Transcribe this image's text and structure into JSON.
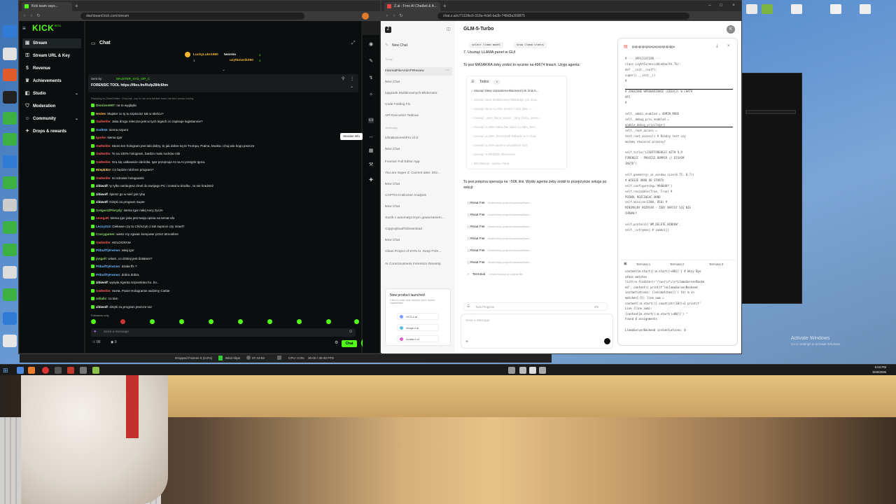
{
  "kick_browser": {
    "tab_title": "Kick team says...",
    "url": "dashboard.kick.com/stream",
    "logo": "KICK",
    "logo_badge": "BETA",
    "nav": [
      {
        "label": "Stream",
        "icon": "stream-icon"
      },
      {
        "label": "Stream URL & Key",
        "icon": "key-icon"
      },
      {
        "label": "Revenue",
        "icon": "dollar-icon"
      },
      {
        "label": "Achievements",
        "icon": "trophy-icon"
      },
      {
        "label": "Studio",
        "icon": "studio-icon"
      },
      {
        "label": "Moderation",
        "icon": "shield-icon"
      },
      {
        "label": "Community",
        "icon": "users-icon"
      },
      {
        "label": "Drops & rewards",
        "icon": "gift-icon"
      }
    ],
    "chat": {
      "title": "Chat",
      "leaderboard": [
        {
          "name": "LuckyLuke1980",
          "count": "1"
        },
        {
          "name": "tworms",
          "count": "1"
        },
        {
          "name": "uzytkownik090",
          "count": "1"
        }
      ],
      "pinned_sender": "Sent by",
      "pinned_user": "MAJSTER_SYS_VIP_C",
      "pinned_text": "FORENSIC TOOL https://files.fm/f/ufp284c6hm",
      "replying": "Replying to ZbmOrbiter: Chuj wie, czy to nie ona bedzie konu nie bez sensu trochę",
      "messages": [
        {
          "user": "Dionizos997",
          "text": "na to wygląda",
          "color": "#8fd36f"
        },
        {
          "user": "Hede6",
          "text": "Majster co ty tu szpiocisz tak w słońcu?",
          "color": "#ffb347"
        },
        {
          "user": "Owl5elite",
          "text": "Jaka droga mleczna jest w tych legach co zapisuje logistiannie?",
          "color": "#ff5c5c"
        },
        {
          "user": "SodKW",
          "text": "siema szpont",
          "color": "#6fb7ff"
        },
        {
          "user": "Igorke",
          "text": "siema Igor",
          "color": "#ff5c5c"
        },
        {
          "user": "Owl5elite",
          "text": "Skoro ten hologram jest taki dobry, to jak dobre są te Trumpa, Putina, Muska i chuj wie kogo jeszcze",
          "color": "#ff5c5c"
        },
        {
          "user": "Owl5elite",
          "text": "To na 100% hologram, bardzo mało ruchów robi",
          "color": "#ff5c5c"
        },
        {
          "user": "Owl5elite",
          "text": "Gra się całkowicie obróciła. Igor przejmuje AI na AI przejęło Igora.",
          "color": "#ff5c5c"
        },
        {
          "user": "WiepkiDJ",
          "text": "Co będzie robił ten program?",
          "color": "#ffd56f"
        },
        {
          "user": "Owl5elite",
          "text": "no zdrowie hologramki",
          "color": "#ff5c5c"
        },
        {
          "user": "zibiwolf",
          "text": "ty tylko ramkujesz dmel do swojego PC i został w środku , to nie kradzież",
          "color": "#ffffff"
        },
        {
          "user": "zibiwolf",
          "text": "śpiesz go w sieć jak rybę",
          "color": "#ffffff"
        },
        {
          "user": "zibiwolf",
          "text": "Dzięki za program Super",
          "color": "#ffffff"
        },
        {
          "user": "GregorzZFlorydy",
          "text": "siema Igor miłej nocy życze",
          "color": "#8fd36f"
        },
        {
          "user": "omegaR",
          "text": "siema igor jaka jest twoja opinia na temat ufo",
          "color": "#ff5c5c"
        },
        {
          "user": "Lecxy313",
          "text": "Ciekawe czy to Chińczyk ci tak suponci czy Izrael?",
          "color": "#6fb7ff"
        },
        {
          "user": "Czorygamer",
          "text": "wiesz my zgwaic komputer przez atmosfere",
          "color": "#8fd36f"
        },
        {
          "user": "Owl5elite",
          "text": "HOLOGRAM",
          "color": "#ff5c5c"
        },
        {
          "user": "PitbullTyKwrwo",
          "text": "witaj igor",
          "color": "#6fb7ff"
        },
        {
          "user": "jozgolt",
          "text": "witam, co dzisiaj jest dolałane?",
          "color": "#8fd36f"
        },
        {
          "user": "PitbullTyKwrwo",
          "text": "działa ffs ?",
          "color": "#6fb7ff"
        },
        {
          "user": "PitbullTyKwrwo",
          "text": "dobra dobra",
          "color": "#6fb7ff"
        },
        {
          "user": "zibiwolf",
          "text": "wysyła Agenta Szpontinka ho..ho..",
          "color": "#ffffff"
        },
        {
          "user": "Owl5elite",
          "text": "HaHa, Panie Hologramie widzimy Ciebie",
          "color": "#ff5c5c"
        },
        {
          "user": "zelialic",
          "text": "co tam",
          "color": "#8fd36f"
        },
        {
          "user": "zibiwolf",
          "text": "dzięki za program jeszcze raz",
          "color": "#ffffff"
        }
      ],
      "followers_only": "Followers only",
      "input_placeholder": "Send a message",
      "viewer_count": "00",
      "points": "0",
      "send_label": "Chat"
    },
    "tooltip": "Session info"
  },
  "z_browser": {
    "tab_title": "Z.ai - Free AI Chatbot & Agent...",
    "url": "chat.z.ai/c/7111fbc6-318a-4cb6-ba3b-748d3a369875",
    "model": "GLM-5-Turbo",
    "new_chat": "New Chat",
    "group_today": "Today",
    "group_yesterday": "Yesterday",
    "history": [
      "InternalFileAndAPIReview",
      "New Chat",
      "Upgrade Multiknownych-Blokerator",
      "Code Folding Fix",
      "API Execution Tedious",
      "UltraBusinessPro v3.0",
      "New Chat",
      "Foxmal: Full Editor App",
      "You are Super Z. Current date: 202...",
      "New Chat",
      "CAPTCHA Blocker Analysis",
      "New Chat",
      "Guzik z automatycznym gowarzaniem...",
      "CopyUploadToDownload",
      "New Chat",
      "Clean Project of DYN AI, Keep FOX...",
      "AI Consciousness Forensics Revamp"
    ],
    "promo_title": "New product launched",
    "promo_text": "Click to enter and explore more model capabilities",
    "promo_links": [
      "OCS.z.ai",
      "image.z.ai",
      "Avatar.z.ai"
    ],
    "code_chips": [
      "select llama model",
      "show llama status"
    ],
    "msg1": "7. Usunąć LLAMA panel w GUI",
    "msg2": "To jest MASAKRA żeby zrobić to ręcznie na 49674 liniach. Użyję agenta:",
    "todos_title": "Todos",
    "todos_count": "9",
    "todos": [
      "Usunąć klasę LlamaServerBackend (ok. linia 5...",
      "Usunąć klasę Multiknownych/Blokdge (ok. linia...",
      "Usunąć menu LLAMA Server z GUI (linie ~...",
      "Usunąć _start_llama_server, _stop_llama_server...",
      "Usunąć LLAMA status bar label i LLAMA_BAC...",
      "Usunąć LLAMA_BACKEND fallbacki w AI chat...",
      "Usunąć LLAMA panel w wszystkich GUI",
      "Usunąć AI-BRIDGE references",
      "Weryfikacja - syntax check"
    ],
    "msg3": "To jest potężna operacja na ~50K linii. Wyślę agenta żeby zrobił to przejrzyście sekcja po sekcji:",
    "tool_calls": [
      {
        "label": "Read File",
        "path": "/home/citmy project/download/foren..."
      },
      {
        "label": "Read File",
        "path": "/home/citmy project/download/foren..."
      },
      {
        "label": "Read File",
        "path": "/home/citmy project/download/foren..."
      },
      {
        "label": "Read File",
        "path": "/home/citmy project/download/foren..."
      },
      {
        "label": "Read File",
        "path": "/home/citmy project/download/foren..."
      },
      {
        "label": "Read File",
        "path": "/home/citmy project/download/foren..."
      }
    ],
    "terminal_call": {
      "label": "Terminal",
      "path": "Create backup of original file"
    },
    "progress_label": "Todo Progress",
    "progress_value": "0/9",
    "input_placeholder": "Send a Message",
    "panel_title": "guguguguguguguguguguguggu",
    "code_lines": [
      "# --- APPLICATION ---",
      "class LightForensicWindow(tk.Tk):",
      "    def __init__(self):",
      "        super().__init__()",
      "#",
      "",
      "# ZAKAZANE WPROWADZANIE (DIEAC3) W CHAT#",
      "API",
      "#",
      "",
      "        self._admin_enabled = ADMIN_MODE",
      "        self._debug_priv_enabled =",
      "enable_debug_privilege()",
      "        self._root_access =",
      "test_root_access()  # Rzadzy test  czy",
      "możemy otwierać procesy?",
      "",
      "        self.title('LIGHTFORENSIC WITH 9.9",
      "FORENSIC - PROCESS DUMPER // DISASM",
      "INGTB')",
      "",
      "self.geometry(_ai_window_size(0.75, 0.7))",
      "# WIESZE OKNO OD STARTU",
      "        self.configure(bg='#0d0d0f')",
      "        self.resizable(True, True)  #",
      "POZWÓL ROZCIĄGAĆ OKNO",
      "        self.minsize(1300, 850)  #",
      "MINIMALNY ROZMIAR - ŻEBY NAPISY SIĘ NIE",
      "CHOWAŁY",
      "",
      "        self.protocol('WM_DELETE_WINDOW',",
      "self._cstrymnej  # zamknij)"
    ],
    "terminal_tabs": [
      "Terminal 1",
      "Terminal 2",
      "Terminal 3"
    ],
    "terminal_lines": [
      "content[m.start():m.start()+80]}') # Wszy Bye",
      "atkas matches",
      "list(re.finditer(r'(\\w+)\\s*=\\s*LlamaServerBacke",
      "nd', content)) print(f'\\nLlamaServerBackend",
      "instantiations: {len(matches)}') for m in",
      "matches[:5]: line_num =",
      "content[:m.start()].count(chr(10))+1 print(f'",
      "Line {line_num}:",
      "{content[m.start():m.start()+80]}') \"",
      "Found 0 assignments",
      "",
      "LlamaServerBackend instantiations: 0"
    ]
  },
  "obs": {
    "dropped": "Dropped Frames 0 (0.0%)",
    "bitrate": "8544 kbps",
    "time": "07:43:53",
    "cpu": "CPU: 0.0%",
    "fps": "30.00 / 30.00 FPS"
  },
  "system": {
    "activate_title": "Activate Windows",
    "activate_sub": "Go to Settings to activate Windows.",
    "clock_time": "6:03 PM",
    "clock_date": "5/26/2026"
  }
}
